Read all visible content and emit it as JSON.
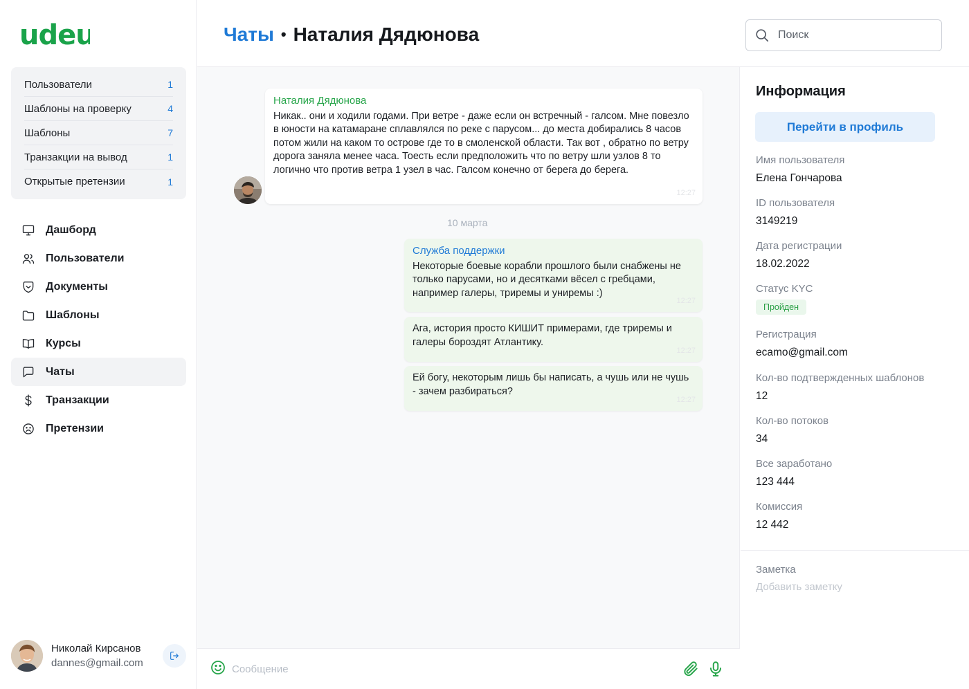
{
  "brand": {
    "logo": "udeu",
    "color": "#1aa34a"
  },
  "sidebar": {
    "counters": [
      {
        "label": "Пользователи",
        "value": "1"
      },
      {
        "label": "Шаблоны на проверку",
        "value": "4"
      },
      {
        "label": "Шаблоны",
        "value": "7"
      },
      {
        "label": "Транзакции на вывод",
        "value": "1"
      },
      {
        "label": "Открытые претензии",
        "value": "1"
      }
    ],
    "nav": [
      {
        "label": "Дашборд",
        "icon": "monitor-icon"
      },
      {
        "label": "Пользователи",
        "icon": "users-icon"
      },
      {
        "label": "Документы",
        "icon": "shield-document-icon"
      },
      {
        "label": "Шаблоны",
        "icon": "folder-icon"
      },
      {
        "label": "Курсы",
        "icon": "book-icon"
      },
      {
        "label": "Чаты",
        "icon": "chat-icon",
        "active": true
      },
      {
        "label": "Транзакции",
        "icon": "dollar-icon"
      },
      {
        "label": "Претензии",
        "icon": "sad-face-icon"
      }
    ],
    "user": {
      "name": "Николай Кирсанов",
      "email": "dannes@gmail.com"
    }
  },
  "header": {
    "section": "Чаты",
    "separator": "•",
    "title": "Наталия Дядюнова",
    "search_placeholder": "Поиск"
  },
  "chat": {
    "incoming": {
      "sender": "Наталия Дядюнова",
      "text": "Никак.. они и ходили годами. При ветре - даже если он встречный - галсом. Мне повезло в юности на катамаране сплавлялся по реке с парусом... до места добирались 8 часов потом жили на каком то острове где то в смоленской области. Так вот , обратно по ветру дорога заняла менее часа. Тоесть если предположить что по ветру шли узлов 8 то логично что против ветра 1 узел в час. Галсом конечно от берега до берега.",
      "time": "12:27"
    },
    "date_separator": "10 марта",
    "outgoing": [
      {
        "sender": "Служба поддержки",
        "text": "Некоторые боевые корабли прошлого были снабжены не только парусами, но и десятками вёсел с гребцами, например галеры, триремы и униремы :)",
        "time": "12:27"
      },
      {
        "text": "Ага, история просто КИШИТ примерами, где триремы и галеры бороздят Атлантику.",
        "time": "12:27"
      },
      {
        "text": "Ей богу, некоторым лишь бы написать, а чушь или не чушь - зачем разбираться?",
        "time": "12:27"
      }
    ],
    "composer_placeholder": "Сообщение"
  },
  "info": {
    "title": "Информация",
    "profile_button": "Перейти в профиль",
    "fields": [
      {
        "label": "Имя пользователя",
        "value": "Елена Гончарова"
      },
      {
        "label": "ID пользователя",
        "value": "3149219"
      },
      {
        "label": "Дата регистрации",
        "value": "18.02.2022"
      },
      {
        "label": "Статус KYC",
        "badge": "Пройден"
      },
      {
        "label": "Регистрация",
        "value": "ecamo@gmail.com"
      },
      {
        "label": "Кол-во подтвержденных шаблонов",
        "value": "12"
      },
      {
        "label": "Кол-во потоков",
        "value": "34"
      },
      {
        "label": "Все заработано",
        "value": "123 444"
      },
      {
        "label": "Комиссия",
        "value": "12 442"
      }
    ],
    "note_label": "Заметка",
    "note_add": "Добавить заметку"
  },
  "colors": {
    "accent_blue": "#1f7ad6",
    "accent_green": "#27a54a",
    "kyc_badge_bg": "#eaf7ec"
  }
}
